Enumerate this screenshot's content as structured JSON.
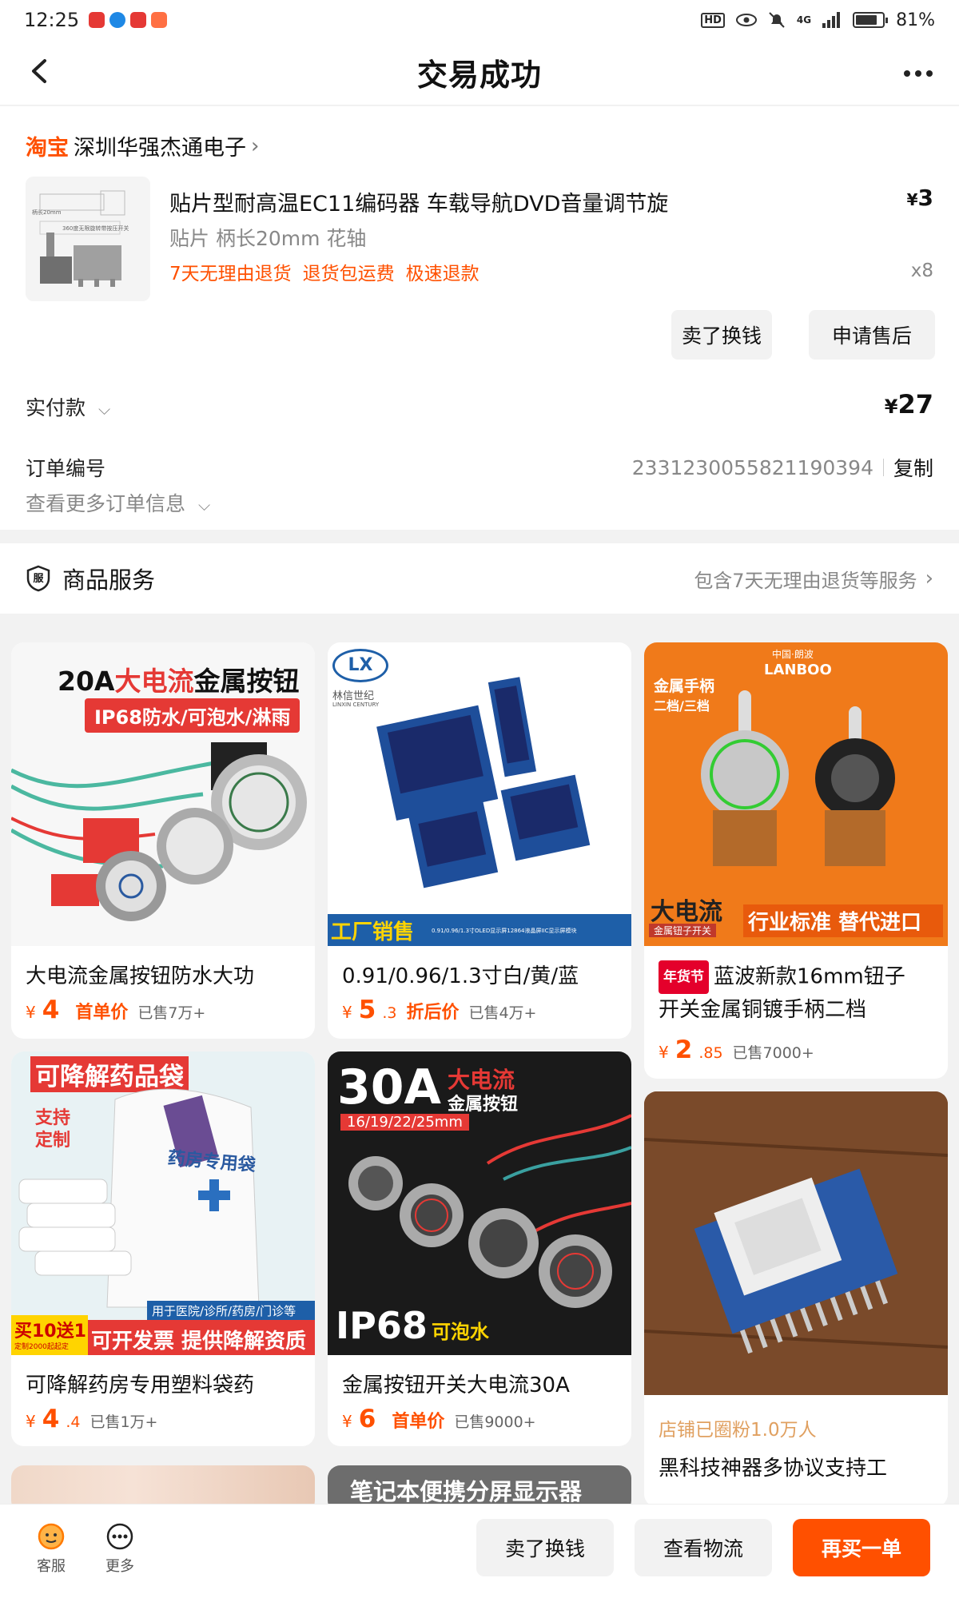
{
  "status": {
    "time": "12:25",
    "network": "4G",
    "battery": "81%",
    "battery_level": 0.81,
    "hd": "HD"
  },
  "nav": {
    "title": "交易成功"
  },
  "shop": {
    "logo": "淘宝",
    "name": "深圳华强杰通电子"
  },
  "product": {
    "title": "贴片型耐高温EC11编码器 车载导航DVD音量调节旋",
    "spec": "贴片 柄长20mm 花轴",
    "tags": [
      "7天无理由退货",
      "退货包运费",
      "极速退款"
    ],
    "price_symbol": "¥",
    "price": "3",
    "qty": "x8",
    "thumb_caption_1": "柄长20mm",
    "thumb_caption_2": "360度无限旋转带按压开关"
  },
  "actions": {
    "sell": "卖了换钱",
    "after_sale": "申请售后"
  },
  "payment": {
    "label": "实付款",
    "symbol": "¥",
    "amount": "27"
  },
  "order": {
    "label": "订单编号",
    "number": "2331230055821190394",
    "copy": "复制",
    "more": "查看更多订单信息"
  },
  "service": {
    "icon_text": "服",
    "title": "商品服务",
    "desc": "包含7天无理由退货等服务"
  },
  "feed": [
    {
      "name": "大电流金属按钮防水大功",
      "yen": "¥",
      "int": "4",
      "frac": "",
      "label": "首单价",
      "sold": "已售7万+",
      "img_title_a": "20A",
      "img_title_b": "大电流",
      "img_title_c": "金属按钮",
      "img_sub": "IP68防水/可泡水/淋雨"
    },
    {
      "name": "0.91/0.96/1.3寸白/黄/蓝",
      "yen": "¥",
      "int": "5",
      "frac": ".3",
      "label": "折后价",
      "sold": "已售4万+",
      "img_logo": "LX",
      "img_brand": "林信世纪",
      "img_brand_en": "LINXIN CENTURY",
      "img_footer": "工厂销售",
      "img_footer_small": "0.91/0.96/1.3寸OLED显示屏12864液晶屏IIC显示屏模块"
    },
    {
      "badge": "年货节",
      "name": "蓝波新款16mm钮子",
      "name2": "开关金属铜镀手柄二档",
      "yen": "¥",
      "int": "2",
      "frac": ".85",
      "label": "",
      "sold": "已售7000+",
      "img_brand": "LANBOO",
      "img_brand_cn": "中国·朗波",
      "img_tl": "金属手柄",
      "img_tl2": "二档/三档",
      "img_bl": "大电流",
      "img_bl_small": "金属钮子开关",
      "img_br": "行业标准 替代进口"
    },
    {
      "name": "可降解药房专用塑料袋药",
      "yen": "¥",
      "int": "4",
      "frac": ".4",
      "label": "",
      "sold": "已售1万+",
      "img_top": "可降解药品袋",
      "img_side": "支持定制",
      "img_bag": "药房专用袋",
      "img_bar": "用于医院/诊所/药房/门诊等",
      "img_promo": "买10送1",
      "img_promo_small": "定制2000起起定",
      "img_promo2": "可开发票 提供降解资质"
    },
    {
      "name": "金属按钮开关大电流30A",
      "yen": "¥",
      "int": "6",
      "frac": "",
      "label": "首单价",
      "sold": "已售9000+",
      "img_big": "30A",
      "img_red": "大电流",
      "img_white": "金属按钮",
      "img_sizes": "16/19/22/25mm",
      "img_ip": "IP68",
      "img_ip_sub": "可泡水"
    },
    {
      "shop_fans": "店铺已圈粉1.0万人",
      "name": "黑科技神器多协议支持工"
    },
    {
      "img_banner": "笔记本便携分屏显示器"
    }
  ],
  "bottom": {
    "service": "客服",
    "more": "更多",
    "sell": "卖了换钱",
    "logistics": "查看物流",
    "rebuy": "再买一单"
  }
}
